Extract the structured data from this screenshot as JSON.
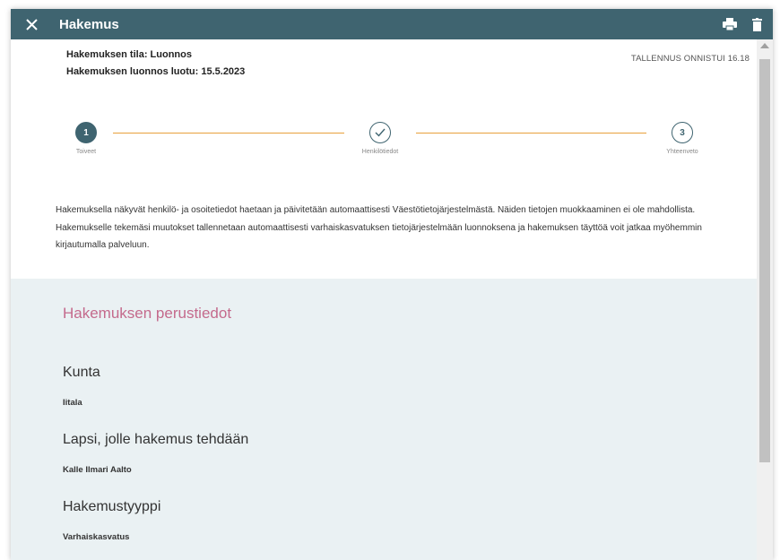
{
  "window": {
    "title": "Hakemus",
    "close_icon": "close-icon",
    "print_icon": "print-icon",
    "delete_icon": "trash-icon"
  },
  "status": {
    "state": "Hakemuksen tila: Luonnos",
    "created": "Hakemuksen luonnos luotu: 15.5.2023",
    "save_status": "TALLENNUS ONNISTUI 16.18"
  },
  "stepper": {
    "steps": [
      {
        "number": "1",
        "label": "Toiveet",
        "state": "active"
      },
      {
        "number": "✓",
        "label": "Henkilötiedot",
        "state": "done"
      },
      {
        "number": "3",
        "label": "Yhteenveto",
        "state": "todo"
      }
    ]
  },
  "info_text": "Hakemuksella näkyvät henkilö- ja osoitetiedot haetaan ja päivitetään automaattisesti Väestötietojärjestelmästä. Näiden tietojen muokkaaminen ei ole mahdollista. Hakemukselle tekemäsi muutokset tallennetaan automaattisesti varhaiskasvatuksen tietojärjestelmään luonnoksena ja hakemuksen täyttöä voit jatkaa myöhemmin kirjautumalla palveluun.",
  "form": {
    "section_title": "Hakemuksen perustiedot",
    "fields": [
      {
        "label": "Kunta",
        "value": "Iitala"
      },
      {
        "label": "Lapsi, jolle hakemus tehdään",
        "value": "Kalle Ilmari Aalto"
      },
      {
        "label": "Hakemustyyppi",
        "value": "Varhaiskasvatus"
      }
    ]
  },
  "colors": {
    "header": "#3f6470",
    "accent_line": "#e8a03c",
    "section_bg": "#eaf1f3",
    "section_title": "#c46a8c"
  }
}
